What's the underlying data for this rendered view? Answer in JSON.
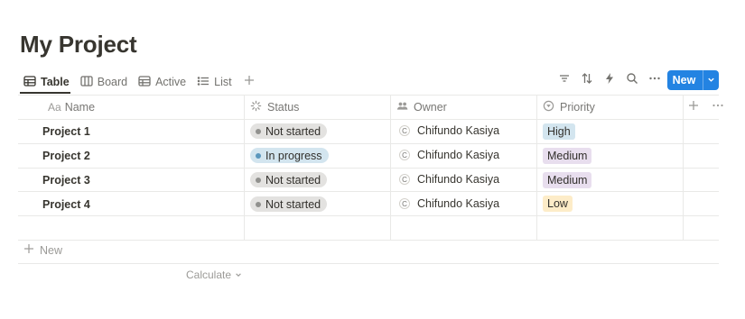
{
  "page": {
    "title": "My Project"
  },
  "views": {
    "tabs": [
      {
        "label": "Table",
        "icon": "table-icon",
        "active": true
      },
      {
        "label": "Board",
        "icon": "board-icon",
        "active": false
      },
      {
        "label": "Active",
        "icon": "table-icon",
        "active": false
      },
      {
        "label": "List",
        "icon": "list-icon",
        "active": false
      }
    ]
  },
  "toolbar": {
    "new_label": "New"
  },
  "columns": [
    {
      "label": "Name",
      "icon": "text-aa-icon"
    },
    {
      "label": "Status",
      "icon": "status-spinner-icon"
    },
    {
      "label": "Owner",
      "icon": "people-icon"
    },
    {
      "label": "Priority",
      "icon": "select-circle-icon"
    }
  ],
  "rows": [
    {
      "name": "Project 1",
      "status": "Not started",
      "status_color": "#e3e2e0",
      "owner_initial": "C",
      "owner": "Chifundo Kasiya",
      "priority": "High",
      "priority_color": "#d3e5ef"
    },
    {
      "name": "Project 2",
      "status": "In progress",
      "status_color": "#d3e5ef",
      "owner_initial": "C",
      "owner": "Chifundo Kasiya",
      "priority": "Medium",
      "priority_color": "#e8deee"
    },
    {
      "name": "Project 3",
      "status": "Not started",
      "status_color": "#e3e2e0",
      "owner_initial": "C",
      "owner": "Chifundo Kasiya",
      "priority": "Medium",
      "priority_color": "#e8deee"
    },
    {
      "name": "Project 4",
      "status": "Not started",
      "status_color": "#e3e2e0",
      "owner_initial": "C",
      "owner": "Chifundo Kasiya",
      "priority": "Low",
      "priority_color": "#fdecc8"
    }
  ],
  "footer": {
    "new_row_label": "New",
    "calculate_label": "Calculate"
  },
  "colors": {
    "accent": "#2383e2",
    "text": "#37352f",
    "muted": "#787774"
  }
}
